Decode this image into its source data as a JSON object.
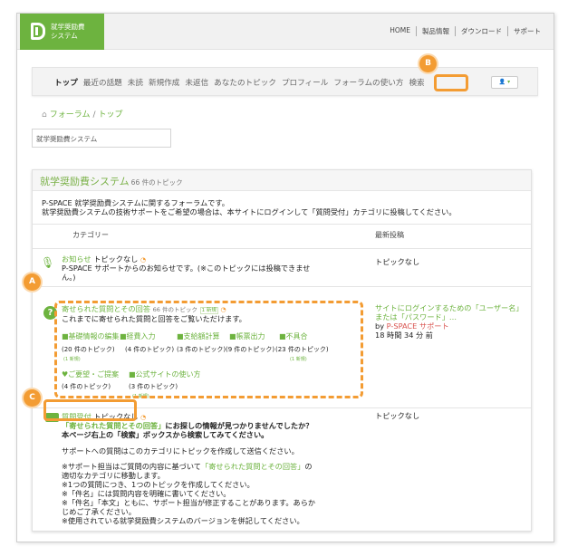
{
  "header": {
    "logo_line1": "就学奨励費",
    "logo_line2": "システム",
    "nav": [
      "HOME",
      "製品情報",
      "ダウンロード",
      "サポート"
    ]
  },
  "main_nav": {
    "tabs": [
      "トップ",
      "最近の話題",
      "未読",
      "新規作成",
      "未返信",
      "あなたのトピック",
      "プロフィール",
      "フォーラムの使い方",
      "検索"
    ],
    "user_button": "👤 ▾"
  },
  "callouts": {
    "a": "A",
    "b": "B",
    "c": "C"
  },
  "breadcrumb": {
    "forum": "フォーラム",
    "sep": "/",
    "top": "トップ"
  },
  "search": {
    "value": "就学奨励費システム"
  },
  "forum": {
    "title": "就学奨励費システム",
    "count": "66 件のトピック",
    "description_line1": "P-SPACE 就学奨励費システムに関するフォーラムです。",
    "description_line2": "就学奨励費システムの技術サポートをご希望の場合は、本サイトにログインして「質問受付」カテゴリに投稿してください。",
    "col_category": "カテゴリー",
    "col_latest": "最新投稿"
  },
  "rows": {
    "news": {
      "title": "お知らせ",
      "topics": "トピックなし",
      "desc": "P-SPACE サポートからのお知らせです。(※このトピックには投稿できませ",
      "desc2": "ん。)",
      "latest": "トピックなし"
    },
    "faq": {
      "title": "寄せられた質問とその回答",
      "count": "66 件のトピック",
      "new": "1 新規",
      "desc": "これまでに寄せられた質問と回答をご覧いただけます。",
      "latest_line1": "サイトにログインするための「ユーザー名」",
      "latest_line2": "または「パスワード」…",
      "latest_by": "by",
      "latest_author": "P-SPACE サポート",
      "latest_time": "18 時間 34 分 前",
      "subs": [
        {
          "label": "■基礎情報の編集",
          "count": "(20 件のトピック)",
          "new": "(1 新規)"
        },
        {
          "label": "■経費入力",
          "count": "(4 件のトピック)",
          "new": ""
        },
        {
          "label": "■支給額計算",
          "count": "(3 件のトピック)",
          "new": ""
        },
        {
          "label": "■帳票出力",
          "count": "(9 件のトピック)",
          "new": ""
        },
        {
          "label": "■不具合",
          "count": "(23 件のトピック)",
          "new": "(1 新規)"
        },
        {
          "label": "♥ご要望・ご提案",
          "count": "(4 件のトピック)",
          "new": ""
        },
        {
          "label": "■公式サイトの使い方",
          "count": "(3 件のトピック)",
          "new": "(1 新規)"
        }
      ]
    },
    "question": {
      "title": "質問受付",
      "topics": "トピックなし",
      "highlight": "「寄せられた質問とその回答」",
      "l1_rest": "にお探しの情報が見つかりませんでしたか？",
      "l2": "本ページ右上の「検索」ボックスから検索してみてください。",
      "l3": "サポートへの質問はこのカテゴリにトピックを作成して送信ください。",
      "l4a": "※サポート担当はご質問の内容に基づいて",
      "l4b": "の",
      "l5": "適切なカテゴリに移動します。",
      "l6": "※1つの質問につき、1つのトピックを作成してください。",
      "l7": "※「件名」には質問内容を明確に書いてください。",
      "l8": "※「件名」「本文」ともに、サポート担当が修正することがあります。あらか",
      "l9": "じめご了承ください。",
      "l10": "※使用されている就学奨励費システムのバージョンを併記してください。",
      "latest": "トピックなし"
    }
  }
}
